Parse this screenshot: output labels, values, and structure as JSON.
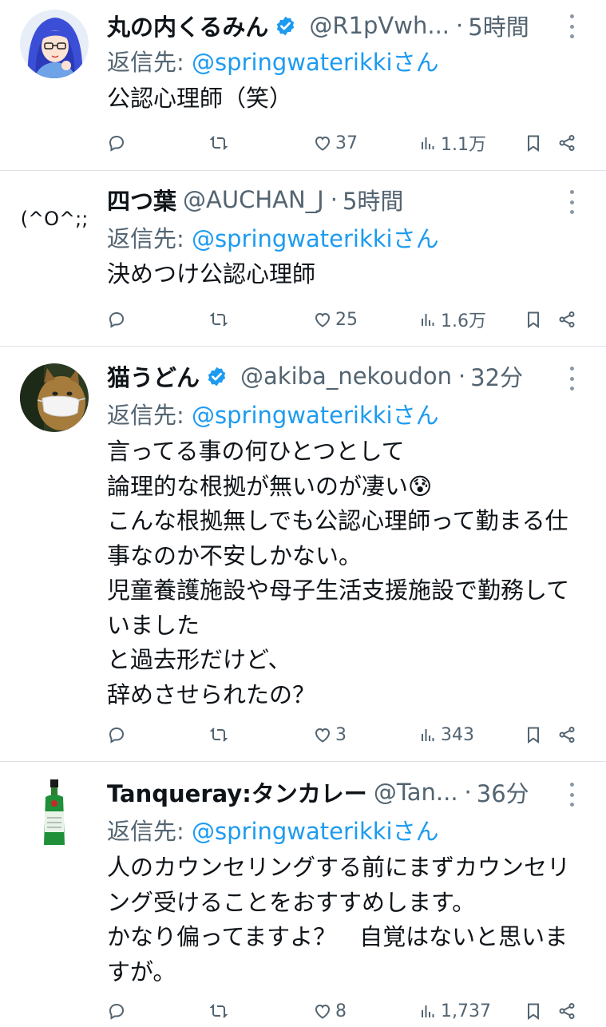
{
  "tweets": [
    {
      "display_name": "丸の内くるみん",
      "verified": true,
      "handle": "@R1pVwh...",
      "time": "5時間",
      "reply_prefix": "返信先: ",
      "reply_handle": "@springwaterikki",
      "reply_suffix": "さん",
      "text": "公認心理師（笑）",
      "reply_count": "",
      "retweet_count": "",
      "like_count": "37",
      "view_count": "1.1万",
      "avatar": "anime-girl-avatar"
    },
    {
      "display_name": "四つ葉",
      "verified": false,
      "handle": "@AUCHAN_J",
      "time": "5時間",
      "reply_prefix": "返信先: ",
      "reply_handle": "@springwaterikki",
      "reply_suffix": "さん",
      "text": "決めつけ公認心理師",
      "reply_count": "",
      "retweet_count": "",
      "like_count": "25",
      "view_count": "1.6万",
      "avatar": "(^O^;;",
      "avatar_text": "(^O^;;"
    },
    {
      "display_name": "猫うどん",
      "verified": true,
      "handle": "@akiba_nekoudon",
      "time": "32分",
      "reply_prefix": "返信先: ",
      "reply_handle": "@springwaterikki",
      "reply_suffix": "さん",
      "text": "言ってる事の何ひとつとして\n論理的な根拠が無いのが凄い😰\nこんな根拠無しでも公認心理師って勤まる仕事なのか不安しかない。\n児童養護施設や母子生活支援施設で勤務していました\nと過去形だけど、\n辞めさせられたの？",
      "reply_count": "",
      "retweet_count": "",
      "like_count": "3",
      "view_count": "343",
      "avatar": "cat-with-mask-avatar"
    },
    {
      "display_name": "Tanqueray:タンカレー",
      "verified": false,
      "handle": "@Tan...",
      "time": "36分",
      "reply_prefix": "返信先: ",
      "reply_handle": "@springwaterikki",
      "reply_suffix": "さん",
      "text": "人のカウンセリングする前にまずカウンセリング受けることをおすすめします。\nかなり偏ってますよ？　自覚はないと思いますが。",
      "reply_count": "",
      "retweet_count": "",
      "like_count": "8",
      "view_count": "1,737",
      "avatar": "gin-bottle-avatar"
    }
  ],
  "colors": {
    "link": "#1d9bf0",
    "secondary": "#536471",
    "verified": "#1d9bf0",
    "separator": "#dfe3e6"
  }
}
